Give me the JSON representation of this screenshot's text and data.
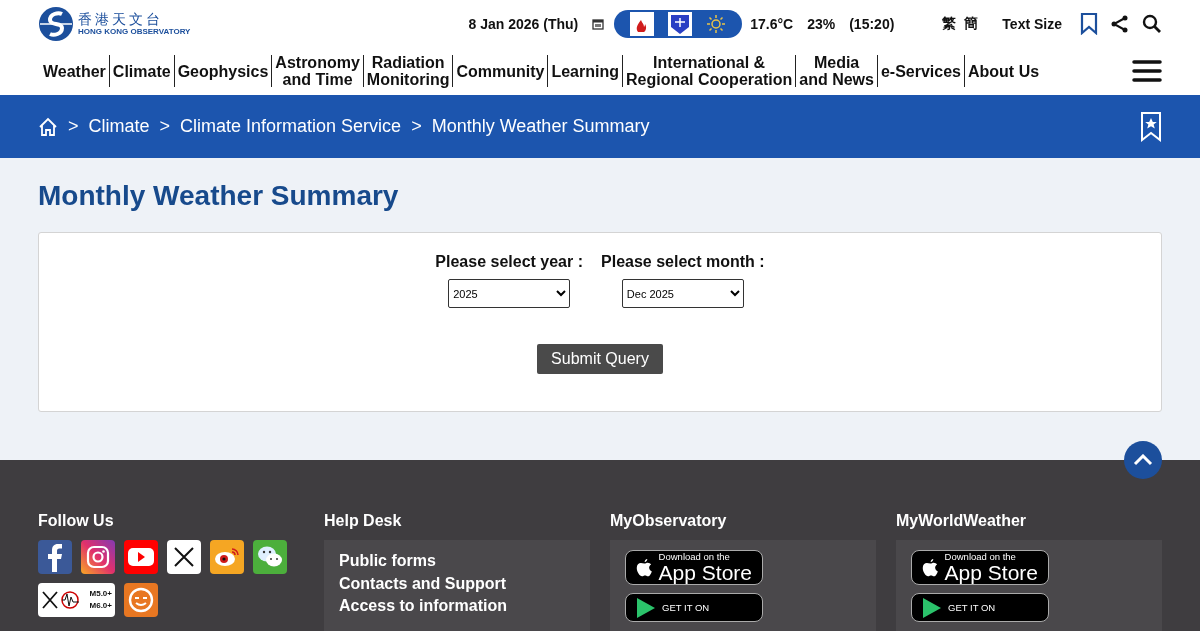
{
  "header": {
    "logo": {
      "name_zh": "香港天文台",
      "name_en": "HONG KONG OBSERVATORY"
    },
    "date": "8 Jan 2026 (Thu)",
    "weather": {
      "temperature": "17.6°C",
      "humidity": "23%",
      "time": "(15:20)"
    },
    "languages": [
      "繁",
      "簡"
    ],
    "text_size": "Text Size"
  },
  "nav": {
    "items": [
      {
        "lines": [
          "Weather"
        ]
      },
      {
        "lines": [
          "Climate"
        ]
      },
      {
        "lines": [
          "Geophysics"
        ]
      },
      {
        "lines": [
          "Astronomy",
          "and Time"
        ]
      },
      {
        "lines": [
          "Radiation",
          "Monitoring"
        ]
      },
      {
        "lines": [
          "Community"
        ]
      },
      {
        "lines": [
          "Learning"
        ]
      },
      {
        "lines": [
          "International &",
          "Regional Cooperation"
        ]
      },
      {
        "lines": [
          "Media",
          "and News"
        ]
      },
      {
        "lines": [
          "e-Services"
        ]
      },
      {
        "lines": [
          "About Us"
        ]
      }
    ]
  },
  "breadcrumb": {
    "separator": ">",
    "items": [
      "Climate",
      "Climate Information Service",
      "Monthly Weather Summary"
    ]
  },
  "page_title": "Monthly Weather Summary",
  "form": {
    "year_label": "Please select year :",
    "year_value": "2025",
    "month_label": "Please select month :",
    "month_value": "Dec 2025",
    "submit": "Submit Query"
  },
  "footer": {
    "follow_us": {
      "title": "Follow Us",
      "quake_labels": [
        "M5.0+",
        "M6.0+"
      ]
    },
    "help_desk": {
      "title": "Help Desk",
      "links": [
        "Public forms",
        "Contacts and Support",
        "Access to information"
      ]
    },
    "apps": [
      {
        "title": "MyObservatory",
        "app_store_top": "Download on the",
        "app_store_main": "App Store",
        "play_top": "GET IT ON"
      },
      {
        "title": "MyWorldWeather",
        "app_store_top": "Download on the",
        "app_store_main": "App Store",
        "play_top": "GET IT ON"
      }
    ]
  }
}
